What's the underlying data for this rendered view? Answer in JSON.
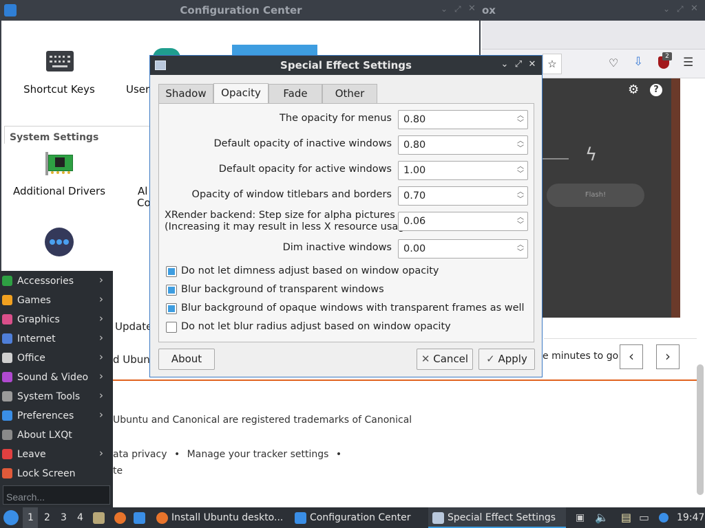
{
  "config_center": {
    "title": "Configuration Center",
    "tiles": {
      "shortcut_keys": "Shortcut Keys",
      "users": "Users",
      "additional_drivers": "Additional Drivers",
      "partial_1": "Al",
      "partial_2": "Co"
    },
    "system_settings_header": "System Settings",
    "partial_update": "Update",
    "partial_ubuntu": "d Ubuntu"
  },
  "browser": {
    "title_fragment": "ox",
    "extension_badge": "2",
    "flash_button": "Flash!",
    "minutes_text": "e minutes to go",
    "trademark": "Ubuntu and Canonical are registered trademarks of Canonical",
    "footer_links": [
      "ata privacy",
      "Manage your tracker settings"
    ],
    "footer_sep": "•",
    "footer_partial": "te",
    "prev": "‹",
    "next": "›"
  },
  "start_menu": {
    "items": [
      {
        "label": "Accessories",
        "color": "#2ea043",
        "arrow": true
      },
      {
        "label": "Games",
        "color": "#f0a020",
        "arrow": true
      },
      {
        "label": "Graphics",
        "color": "#d94f8a",
        "arrow": true
      },
      {
        "label": "Internet",
        "color": "#4f7fd9",
        "arrow": true
      },
      {
        "label": "Office",
        "color": "#d0d0d0",
        "arrow": true
      },
      {
        "label": "Sound & Video",
        "color": "#b04ad0",
        "arrow": true
      },
      {
        "label": "System Tools",
        "color": "#9a9a9a",
        "arrow": true
      },
      {
        "label": "Preferences",
        "color": "#3a8ee6",
        "arrow": true
      },
      {
        "label": "About LXQt",
        "color": "#8a8a8a",
        "arrow": false
      },
      {
        "label": "Leave",
        "color": "#e04040",
        "arrow": true
      },
      {
        "label": "Lock Screen",
        "color": "#e05a3a",
        "arrow": false
      }
    ],
    "search_placeholder": "Search...",
    "arrow_glyph": "›"
  },
  "dialog": {
    "title": "Special Effect Settings",
    "window_buttons": {
      "minimize": "⌄",
      "maximize": "⤢",
      "close": "✕"
    },
    "tabs": [
      "Shadow",
      "Opacity",
      "Fade",
      "Other"
    ],
    "active_tab": "Opacity",
    "fields": [
      {
        "label": "The opacity for menus",
        "value": "0.80"
      },
      {
        "label": "Default opacity of inactive windows",
        "value": "0.80"
      },
      {
        "label": "Default opacity for active windows",
        "value": "1.00"
      },
      {
        "label": "Opacity of window titlebars and borders",
        "value": "0.70"
      },
      {
        "label": "XRender backend: Step size for alpha pictures",
        "label2": "(Increasing it may result in less X resource usage)",
        "value": "0.06"
      },
      {
        "label": "Dim inactive windows",
        "value": "0.00"
      }
    ],
    "checkboxes": [
      {
        "label": "Do not let dimness adjust based on window opacity",
        "checked": true
      },
      {
        "label": "Blur background of transparent windows",
        "checked": true
      },
      {
        "label": "Blur background of opaque windows with transparent frames as well",
        "checked": true
      },
      {
        "label": "Do not let blur radius adjust based on window opacity",
        "checked": false
      }
    ],
    "buttons": {
      "about": "About",
      "cancel": "Cancel",
      "apply": "Apply",
      "cancel_glyph": "✕",
      "apply_glyph": "✓"
    }
  },
  "taskbar": {
    "desktops": [
      "1",
      "2",
      "3",
      "4"
    ],
    "tasks": [
      {
        "label": "Install Ubuntu deskto...",
        "icon_color": "#e8742b"
      },
      {
        "label": "Configuration Center",
        "icon_color": "#3a8ee6"
      },
      {
        "label": "Special Effect Settings",
        "icon_color": "#b9c8dc"
      }
    ],
    "clock": "19:47"
  },
  "colors": {
    "accent": "#3b79c3",
    "check": "#3e9de0",
    "menu_bg": "#2a2e33",
    "taskbar_bg": "#2c3036",
    "orange_rule": "#e0621e"
  }
}
